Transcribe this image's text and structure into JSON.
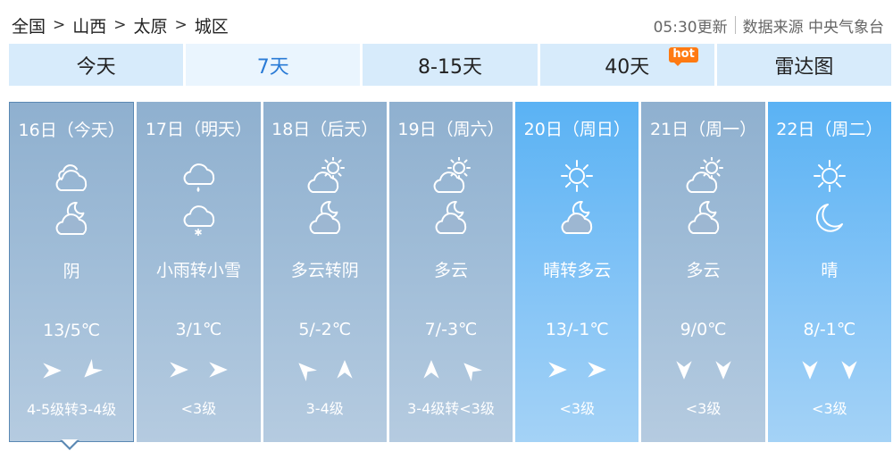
{
  "breadcrumb": [
    "全国",
    "山西",
    "太原",
    "城区"
  ],
  "update": {
    "time": "05:30更新",
    "source": "数据来源 中央气象台"
  },
  "tabs": [
    {
      "label": "今天",
      "active": false,
      "hot": ""
    },
    {
      "label": "7天",
      "active": true,
      "hot": ""
    },
    {
      "label": "8-15天",
      "active": false,
      "hot": ""
    },
    {
      "label": "40天",
      "active": false,
      "hot": "hot"
    },
    {
      "label": "雷达图",
      "active": false,
      "hot": ""
    }
  ],
  "days": [
    {
      "date": "16日（今天）",
      "day_icon": "cloudy-icon",
      "night_icon": "partly-cloudy-night-icon",
      "desc": "阴",
      "temp": "13/5℃",
      "wind_dirs": [
        "east",
        "southwest"
      ],
      "wind_level": "4-5级转3-4级",
      "theme": "gray",
      "today": true
    },
    {
      "date": "17日（明天）",
      "day_icon": "light-rain-icon",
      "night_icon": "light-snow-icon",
      "desc": "小雨转小雪",
      "temp": "3/1℃",
      "wind_dirs": [
        "east",
        "east"
      ],
      "wind_level": "<3级",
      "theme": "gray",
      "today": false
    },
    {
      "date": "18日（后天）",
      "day_icon": "partly-cloudy-day-icon",
      "night_icon": "partly-cloudy-night-icon",
      "desc": "多云转阴",
      "temp": "5/-2℃",
      "wind_dirs": [
        "northwest",
        "north"
      ],
      "wind_level": "3-4级",
      "theme": "gray",
      "today": false
    },
    {
      "date": "19日（周六）",
      "day_icon": "partly-cloudy-day-icon",
      "night_icon": "partly-cloudy-night-icon",
      "desc": "多云",
      "temp": "7/-3℃",
      "wind_dirs": [
        "north",
        "northwest"
      ],
      "wind_level": "3-4级转<3级",
      "theme": "gray",
      "today": false
    },
    {
      "date": "20日（周日）",
      "day_icon": "sunny-icon",
      "night_icon": "partly-cloudy-night-icon",
      "desc": "晴转多云",
      "temp": "13/-1℃",
      "wind_dirs": [
        "east",
        "east"
      ],
      "wind_level": "<3级",
      "theme": "blue",
      "today": false
    },
    {
      "date": "21日（周一）",
      "day_icon": "partly-cloudy-day-icon",
      "night_icon": "partly-cloudy-night-icon",
      "desc": "多云",
      "temp": "9/0℃",
      "wind_dirs": [
        "south",
        "south"
      ],
      "wind_level": "<3级",
      "theme": "gray",
      "today": false
    },
    {
      "date": "22日（周二）",
      "day_icon": "sunny-icon",
      "night_icon": "clear-night-icon",
      "desc": "晴",
      "temp": "8/-1℃",
      "wind_dirs": [
        "south",
        "south"
      ],
      "wind_level": "<3级",
      "theme": "blue",
      "today": false
    }
  ]
}
